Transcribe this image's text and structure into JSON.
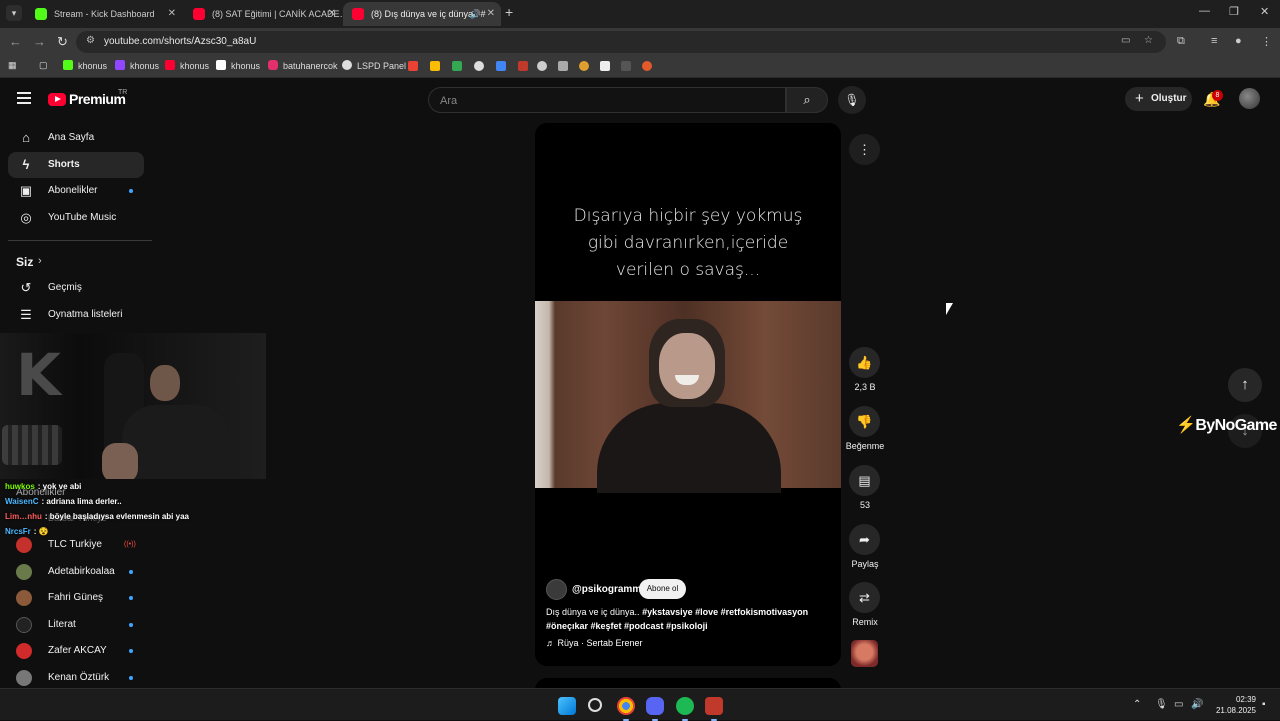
{
  "browser": {
    "tabs": [
      {
        "title": "Stream - Kick Dashboard",
        "color": "#53fc18"
      },
      {
        "title": "(8) SAT Eğitimi | CANİK ACADE…",
        "color": "#ff0033"
      },
      {
        "title": "(8) Dış dünya ve iç dünya.. #",
        "color": "#ff0033"
      }
    ],
    "url": "youtube.com/shorts/Azsc30_a8aU",
    "bookmarks": [
      {
        "label": "khonus",
        "color": "#53fc18"
      },
      {
        "label": "khonus",
        "color": "#9146ff"
      },
      {
        "label": "khonus",
        "color": "#ff0033"
      },
      {
        "label": "khonus",
        "color": "#ffffff"
      },
      {
        "label": "batuhanercok",
        "color": "#e1306c"
      },
      {
        "label": "LSPD Panel",
        "color": "#dddddd"
      }
    ]
  },
  "header": {
    "logo": "Premium",
    "country": "TR",
    "search_placeholder": "Ara",
    "create_label": "Oluştur",
    "notification_count": "8"
  },
  "sidebar": {
    "items": [
      {
        "label": "Ana Sayfa",
        "icon": "home-icon"
      },
      {
        "label": "Shorts",
        "icon": "shorts-icon"
      },
      {
        "label": "Abonelikler",
        "icon": "subscriptions-icon"
      },
      {
        "label": "YouTube Music",
        "icon": "music-icon"
      }
    ],
    "you_section": "Siz",
    "you_items": [
      {
        "label": "Geçmiş",
        "icon": "history-icon"
      },
      {
        "label": "Oynatma listeleri",
        "icon": "playlist-icon"
      }
    ],
    "subs_title": "Abonelikler",
    "channels": [
      {
        "label": "TLC Turkiye",
        "color": "#c4302b"
      },
      {
        "label": "Adetabirkoalaa",
        "color": "#6b7a4a"
      },
      {
        "label": "Fahri Güneş",
        "color": "#8a5a3a"
      },
      {
        "label": "Literat",
        "color": "#222222"
      },
      {
        "label": "Zafer AKCAY",
        "color": "#d12a2a"
      },
      {
        "label": "Kenan Öztürk",
        "color": "#777777"
      }
    ],
    "ghost_label": "Barbar Turkiye"
  },
  "chat": [
    {
      "user": "huwkos",
      "text": ": yok ve abi",
      "color": "#7cfc00"
    },
    {
      "user": "WaisenC",
      "text": ": adriana lima derler..",
      "color": "#4db8ff"
    },
    {
      "user": "Lim…nhu",
      "text": ": böyle başladıysa evlenmesin abi yaa",
      "color": "#ff5c5c"
    },
    {
      "user": "NrcsFr",
      "text": ": 😵",
      "color": "#4db8ff"
    }
  ],
  "short": {
    "caption_lines": [
      "Dışarıya hiçbir şey yokmuş",
      "gibi davranırken,içeride",
      "verilen o savaş..."
    ],
    "channel": "@psikogramm",
    "subscribe_label": "Abone ol",
    "description_text": "Dış dünya ve iç dünya.. ",
    "description_tags": "#ykstavsiye #love #retfokismotivasyon #öneçıkar #keşfet #podcast #psikoloji",
    "music": "Rüya · Sertab Erener",
    "likes": "2,3 B",
    "dislike_label": "Beğenme",
    "comments": "53",
    "share_label": "Paylaş",
    "remix_label": "Remix"
  },
  "overlay": {
    "sponsor": "ByNoGame"
  },
  "taskbar": {
    "time": "02:39",
    "date": "21.08.2025"
  }
}
